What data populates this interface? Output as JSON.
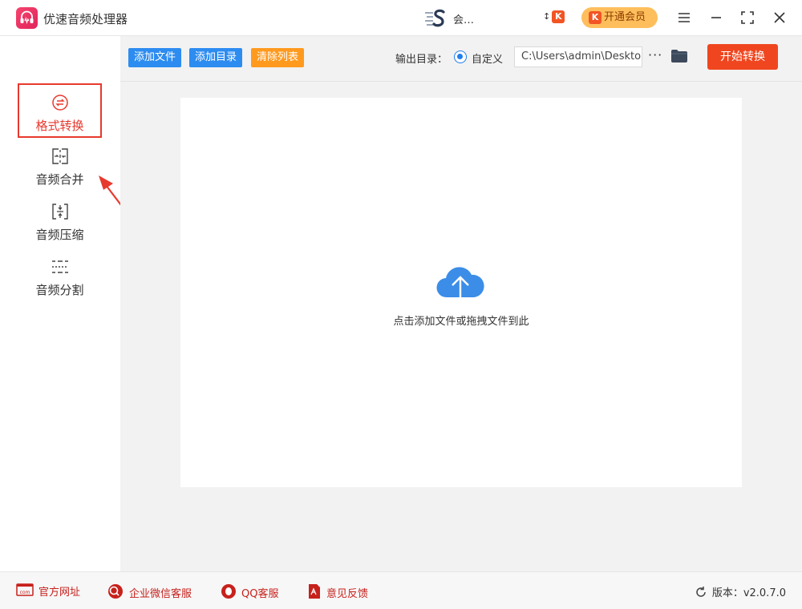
{
  "app": {
    "title": "优速音频处理器"
  },
  "header": {
    "user_name": "会…",
    "vip_label": "开通会员",
    "k_badge": "K"
  },
  "sidebar": {
    "items": [
      {
        "label": "格式转换",
        "icon": "format-convert-icon",
        "active": true
      },
      {
        "label": "音频合并",
        "icon": "audio-merge-icon",
        "active": false
      },
      {
        "label": "音频压缩",
        "icon": "audio-compress-icon",
        "active": false
      },
      {
        "label": "音频分割",
        "icon": "audio-split-icon",
        "active": false
      }
    ]
  },
  "toolbar": {
    "add_file": "添加文件",
    "add_dir": "添加目录",
    "clear_list": "清除列表",
    "output_label": "输出目录：",
    "radio_label": "自定义",
    "path_value": "C:\\Users\\admin\\Deskto",
    "more": "···",
    "start": "开始转换"
  },
  "main": {
    "drop_hint": "点击添加文件或拖拽文件到此"
  },
  "footer": {
    "website": "官方网址",
    "wechat": "企业微信客服",
    "qq": "QQ客服",
    "feedback": "意见反馈",
    "version": "版本：v2.0.7.0"
  },
  "colors": {
    "accent_red": "#e8392e",
    "primary_blue": "#2d8cf0",
    "orange": "#ff9a1f",
    "start_button": "#f0461f",
    "vip_gold": "#ffbe5c"
  }
}
